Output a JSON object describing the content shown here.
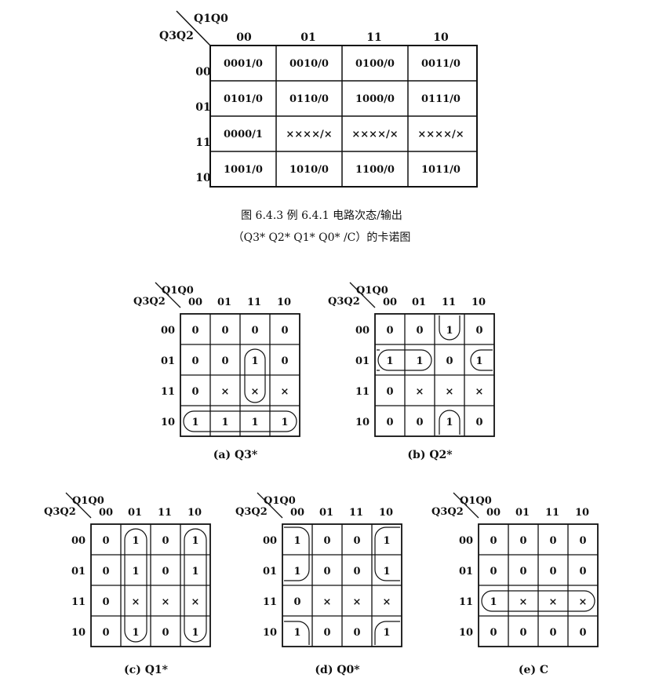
{
  "main_map": {
    "row_var_label": "Q3Q2",
    "col_var_label": "Q1Q0",
    "col_headers": [
      "00",
      "01",
      "11",
      "10"
    ],
    "row_headers": [
      "00",
      "01",
      "11",
      "10"
    ],
    "cells": [
      [
        "0001/0",
        "0010/0",
        "0100/0",
        "0011/0"
      ],
      [
        "0101/0",
        "0110/0",
        "1000/0",
        "0111/0"
      ],
      [
        "0000/1",
        "××××/×",
        "××××/×",
        "××××/×"
      ],
      [
        "1001/0",
        "1010/0",
        "1100/0",
        "1011/0"
      ]
    ]
  },
  "caption": {
    "line1": "图 6.4.3   例 6.4.1 电路次态/输出",
    "line2": "（Q3* Q2* Q1* Q0* /C）的卡诺图"
  },
  "sub_maps": [
    {
      "label": "(a) Q3*",
      "row_var_label": "Q3Q2",
      "col_var_label": "Q1Q0",
      "col_headers": [
        "00",
        "01",
        "11",
        "10"
      ],
      "row_headers": [
        "00",
        "01",
        "11",
        "10"
      ],
      "cells": [
        [
          "0",
          "0",
          "0",
          "0"
        ],
        [
          "0",
          "0",
          "1",
          "0"
        ],
        [
          "0",
          "×",
          "×",
          "×"
        ],
        [
          "1",
          "1",
          "1",
          "1"
        ]
      ]
    },
    {
      "label": "(b) Q2*",
      "row_var_label": "Q3Q2",
      "col_var_label": "Q1Q0",
      "col_headers": [
        "00",
        "01",
        "11",
        "10"
      ],
      "row_headers": [
        "00",
        "01",
        "11",
        "10"
      ],
      "cells": [
        [
          "0",
          "0",
          "1",
          "0"
        ],
        [
          "1",
          "1",
          "0",
          "1"
        ],
        [
          "0",
          "×",
          "×",
          "×"
        ],
        [
          "0",
          "0",
          "1",
          "0"
        ]
      ]
    },
    {
      "label": "(c) Q1*",
      "row_var_label": "Q3Q2",
      "col_var_label": "Q1Q0",
      "col_headers": [
        "00",
        "01",
        "11",
        "10"
      ],
      "row_headers": [
        "00",
        "01",
        "11",
        "10"
      ],
      "cells": [
        [
          "0",
          "1",
          "0",
          "1"
        ],
        [
          "0",
          "1",
          "0",
          "1"
        ],
        [
          "0",
          "×",
          "×",
          "×"
        ],
        [
          "0",
          "1",
          "0",
          "1"
        ]
      ]
    },
    {
      "label": "(d) Q0*",
      "row_var_label": "Q3Q2",
      "col_var_label": "Q1Q0",
      "col_headers": [
        "00",
        "01",
        "11",
        "10"
      ],
      "row_headers": [
        "00",
        "01",
        "11",
        "10"
      ],
      "cells": [
        [
          "1",
          "0",
          "0",
          "1"
        ],
        [
          "1",
          "0",
          "0",
          "1"
        ],
        [
          "0",
          "×",
          "×",
          "×"
        ],
        [
          "1",
          "0",
          "0",
          "1"
        ]
      ]
    },
    {
      "label": "(e) C",
      "row_var_label": "Q3Q2",
      "col_var_label": "Q1Q0",
      "col_headers": [
        "00",
        "01",
        "11",
        "10"
      ],
      "row_headers": [
        "00",
        "01",
        "11",
        "10"
      ],
      "cells": [
        [
          "0",
          "0",
          "0",
          "0"
        ],
        [
          "0",
          "0",
          "0",
          "0"
        ],
        [
          "1",
          "×",
          "×",
          "×"
        ],
        [
          "0",
          "0",
          "0",
          "0"
        ]
      ]
    }
  ]
}
